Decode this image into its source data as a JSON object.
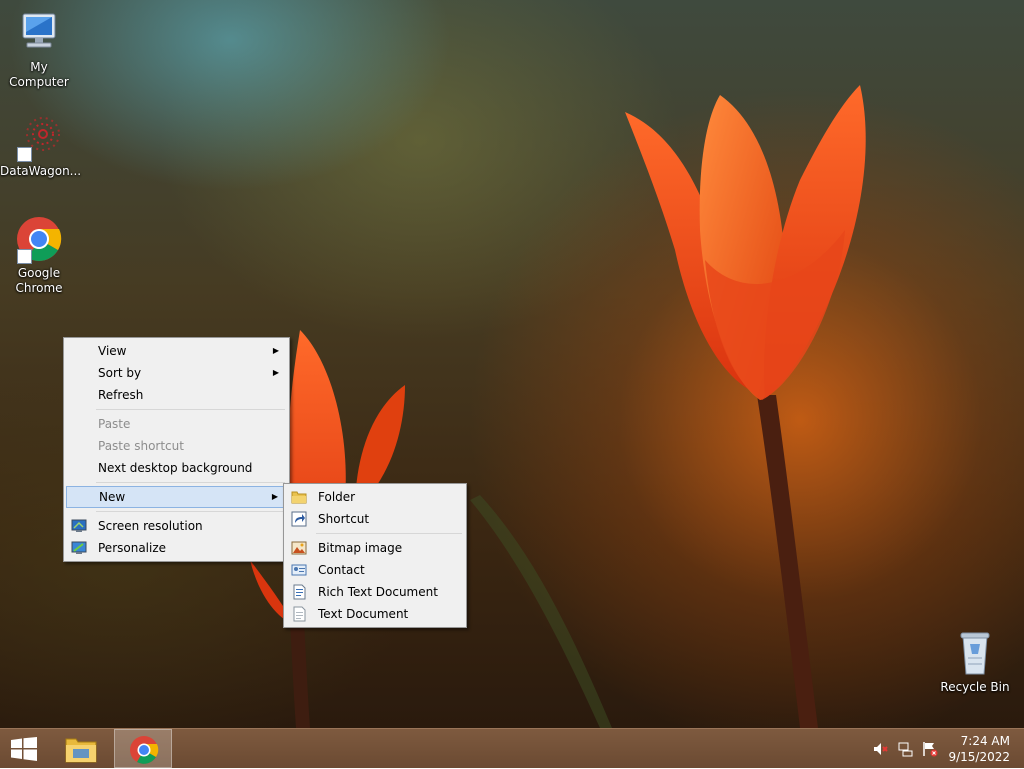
{
  "desktop": {
    "icons": [
      {
        "label": "My Computer",
        "icon": "computer-icon"
      },
      {
        "label": "DataWagon...",
        "icon": "datawagon-icon"
      },
      {
        "label": "Google Chrome",
        "icon": "chrome-icon"
      },
      {
        "label": "Recycle Bin",
        "icon": "recycle-bin-icon"
      }
    ]
  },
  "context_menu": {
    "items": [
      {
        "label": "View",
        "submenu": true
      },
      {
        "label": "Sort by",
        "submenu": true
      },
      {
        "label": "Refresh"
      },
      {
        "label": "Paste",
        "disabled": true
      },
      {
        "label": "Paste shortcut",
        "disabled": true
      },
      {
        "label": "Next desktop background"
      },
      {
        "label": "New",
        "submenu": true,
        "highlighted": true
      },
      {
        "label": "Screen resolution",
        "icon": "screen-resolution-icon"
      },
      {
        "label": "Personalize",
        "icon": "personalize-icon"
      }
    ]
  },
  "new_submenu": {
    "items": [
      {
        "label": "Folder",
        "icon": "folder-icon"
      },
      {
        "label": "Shortcut",
        "icon": "shortcut-icon"
      },
      {
        "label": "Bitmap image",
        "icon": "bitmap-icon"
      },
      {
        "label": "Contact",
        "icon": "contact-icon"
      },
      {
        "label": "Rich Text Document",
        "icon": "rich-text-icon"
      },
      {
        "label": "Text Document",
        "icon": "text-document-icon"
      }
    ]
  },
  "taskbar": {
    "start": {
      "icon": "windows-logo-icon"
    },
    "pinned": [
      {
        "icon": "file-explorer-icon",
        "active": false
      },
      {
        "icon": "chrome-icon",
        "active": true
      }
    ],
    "tray": [
      {
        "icon": "volume-muted-icon"
      },
      {
        "icon": "network-icon"
      },
      {
        "icon": "action-center-flag-icon"
      }
    ],
    "clock": {
      "time": "7:24 AM",
      "date": "9/15/2022"
    }
  },
  "colors": {
    "taskbar": "#6b4a32",
    "menu_background": "#f0f0f0",
    "menu_highlight": "#d5e4f6",
    "tulip": "#f05a1c"
  }
}
